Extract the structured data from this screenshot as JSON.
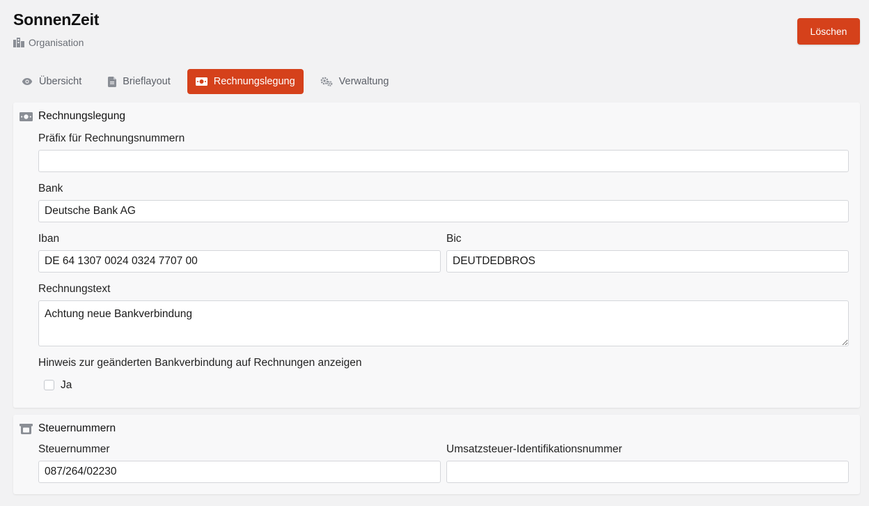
{
  "header": {
    "title": "SonnenZeit",
    "subtitle": "Organisation",
    "delete_label": "Löschen"
  },
  "tabs": [
    {
      "label": "Übersicht",
      "icon": "eye-icon",
      "active": false
    },
    {
      "label": "Brieflayout",
      "icon": "document-icon",
      "active": false
    },
    {
      "label": "Rechnungslegung",
      "icon": "money-icon",
      "active": true
    },
    {
      "label": "Verwaltung",
      "icon": "cogs-icon",
      "active": false
    }
  ],
  "rechnung": {
    "heading": "Rechnungslegung",
    "prefix_label": "Präfix für Rechnungsnummern",
    "prefix_value": "",
    "bank_label": "Bank",
    "bank_value": "Deutsche Bank AG",
    "iban_label": "Iban",
    "iban_value": "DE 64 1307 0024 0324 7707 00",
    "bic_label": "Bic",
    "bic_value": "DEUTDEDBROS",
    "text_label": "Rechnungstext",
    "text_value": "Achtung neue Bankverbindung",
    "notice_label": "Hinweis zur geänderten Bankverbindung auf Rechnungen anzeigen",
    "notice_option": "Ja",
    "notice_checked": false
  },
  "steuer": {
    "heading": "Steuernummern",
    "steuer_label": "Steuernummer",
    "steuer_value": "087/264/02230",
    "ust_label": "Umsatzsteuer-Identifikationsnummer",
    "ust_value": ""
  },
  "colors": {
    "accent": "#d5411b",
    "background": "#f2f2f3",
    "panel": "#f8f8f9"
  }
}
